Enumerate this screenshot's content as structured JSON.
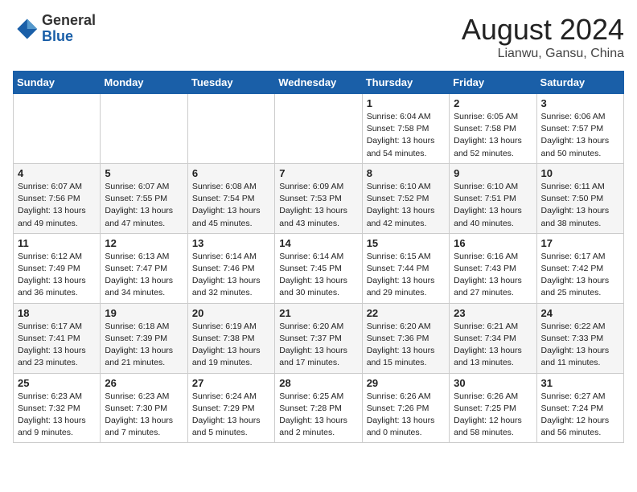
{
  "header": {
    "logo_general": "General",
    "logo_blue": "Blue",
    "month_title": "August 2024",
    "location": "Lianwu, Gansu, China"
  },
  "weekdays": [
    "Sunday",
    "Monday",
    "Tuesday",
    "Wednesday",
    "Thursday",
    "Friday",
    "Saturday"
  ],
  "weeks": [
    [
      {
        "day": "",
        "info": ""
      },
      {
        "day": "",
        "info": ""
      },
      {
        "day": "",
        "info": ""
      },
      {
        "day": "",
        "info": ""
      },
      {
        "day": "1",
        "info": "Sunrise: 6:04 AM\nSunset: 7:58 PM\nDaylight: 13 hours\nand 54 minutes."
      },
      {
        "day": "2",
        "info": "Sunrise: 6:05 AM\nSunset: 7:58 PM\nDaylight: 13 hours\nand 52 minutes."
      },
      {
        "day": "3",
        "info": "Sunrise: 6:06 AM\nSunset: 7:57 PM\nDaylight: 13 hours\nand 50 minutes."
      }
    ],
    [
      {
        "day": "4",
        "info": "Sunrise: 6:07 AM\nSunset: 7:56 PM\nDaylight: 13 hours\nand 49 minutes."
      },
      {
        "day": "5",
        "info": "Sunrise: 6:07 AM\nSunset: 7:55 PM\nDaylight: 13 hours\nand 47 minutes."
      },
      {
        "day": "6",
        "info": "Sunrise: 6:08 AM\nSunset: 7:54 PM\nDaylight: 13 hours\nand 45 minutes."
      },
      {
        "day": "7",
        "info": "Sunrise: 6:09 AM\nSunset: 7:53 PM\nDaylight: 13 hours\nand 43 minutes."
      },
      {
        "day": "8",
        "info": "Sunrise: 6:10 AM\nSunset: 7:52 PM\nDaylight: 13 hours\nand 42 minutes."
      },
      {
        "day": "9",
        "info": "Sunrise: 6:10 AM\nSunset: 7:51 PM\nDaylight: 13 hours\nand 40 minutes."
      },
      {
        "day": "10",
        "info": "Sunrise: 6:11 AM\nSunset: 7:50 PM\nDaylight: 13 hours\nand 38 minutes."
      }
    ],
    [
      {
        "day": "11",
        "info": "Sunrise: 6:12 AM\nSunset: 7:49 PM\nDaylight: 13 hours\nand 36 minutes."
      },
      {
        "day": "12",
        "info": "Sunrise: 6:13 AM\nSunset: 7:47 PM\nDaylight: 13 hours\nand 34 minutes."
      },
      {
        "day": "13",
        "info": "Sunrise: 6:14 AM\nSunset: 7:46 PM\nDaylight: 13 hours\nand 32 minutes."
      },
      {
        "day": "14",
        "info": "Sunrise: 6:14 AM\nSunset: 7:45 PM\nDaylight: 13 hours\nand 30 minutes."
      },
      {
        "day": "15",
        "info": "Sunrise: 6:15 AM\nSunset: 7:44 PM\nDaylight: 13 hours\nand 29 minutes."
      },
      {
        "day": "16",
        "info": "Sunrise: 6:16 AM\nSunset: 7:43 PM\nDaylight: 13 hours\nand 27 minutes."
      },
      {
        "day": "17",
        "info": "Sunrise: 6:17 AM\nSunset: 7:42 PM\nDaylight: 13 hours\nand 25 minutes."
      }
    ],
    [
      {
        "day": "18",
        "info": "Sunrise: 6:17 AM\nSunset: 7:41 PM\nDaylight: 13 hours\nand 23 minutes."
      },
      {
        "day": "19",
        "info": "Sunrise: 6:18 AM\nSunset: 7:39 PM\nDaylight: 13 hours\nand 21 minutes."
      },
      {
        "day": "20",
        "info": "Sunrise: 6:19 AM\nSunset: 7:38 PM\nDaylight: 13 hours\nand 19 minutes."
      },
      {
        "day": "21",
        "info": "Sunrise: 6:20 AM\nSunset: 7:37 PM\nDaylight: 13 hours\nand 17 minutes."
      },
      {
        "day": "22",
        "info": "Sunrise: 6:20 AM\nSunset: 7:36 PM\nDaylight: 13 hours\nand 15 minutes."
      },
      {
        "day": "23",
        "info": "Sunrise: 6:21 AM\nSunset: 7:34 PM\nDaylight: 13 hours\nand 13 minutes."
      },
      {
        "day": "24",
        "info": "Sunrise: 6:22 AM\nSunset: 7:33 PM\nDaylight: 13 hours\nand 11 minutes."
      }
    ],
    [
      {
        "day": "25",
        "info": "Sunrise: 6:23 AM\nSunset: 7:32 PM\nDaylight: 13 hours\nand 9 minutes."
      },
      {
        "day": "26",
        "info": "Sunrise: 6:23 AM\nSunset: 7:30 PM\nDaylight: 13 hours\nand 7 minutes."
      },
      {
        "day": "27",
        "info": "Sunrise: 6:24 AM\nSunset: 7:29 PM\nDaylight: 13 hours\nand 5 minutes."
      },
      {
        "day": "28",
        "info": "Sunrise: 6:25 AM\nSunset: 7:28 PM\nDaylight: 13 hours\nand 2 minutes."
      },
      {
        "day": "29",
        "info": "Sunrise: 6:26 AM\nSunset: 7:26 PM\nDaylight: 13 hours\nand 0 minutes."
      },
      {
        "day": "30",
        "info": "Sunrise: 6:26 AM\nSunset: 7:25 PM\nDaylight: 12 hours\nand 58 minutes."
      },
      {
        "day": "31",
        "info": "Sunrise: 6:27 AM\nSunset: 7:24 PM\nDaylight: 12 hours\nand 56 minutes."
      }
    ]
  ]
}
